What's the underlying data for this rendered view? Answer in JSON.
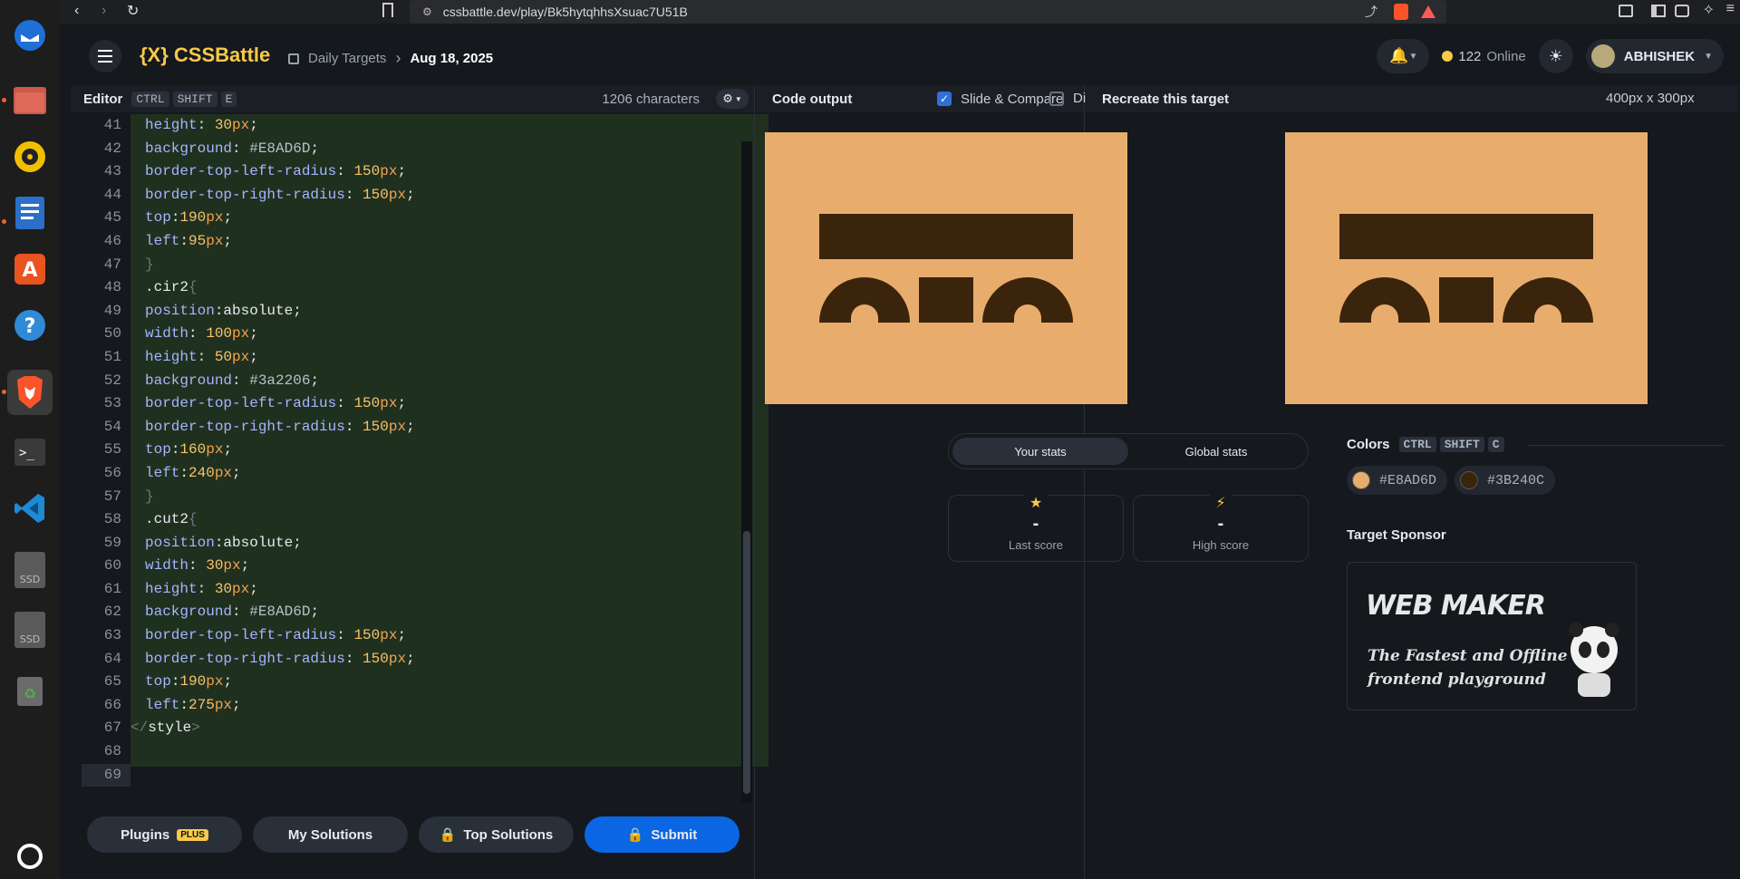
{
  "browser": {
    "url": "cssbattle.dev/play/Bk5hytqhhsXsuac7U51B"
  },
  "dock": {
    "items": [
      "thunderbird-icon",
      "files-icon",
      "rhythmbox-icon",
      "writer-icon",
      "app-center-icon",
      "help-icon",
      "brave-icon",
      "terminal-icon",
      "vscode-icon",
      "ssd-drive-icon",
      "ssd-drive-icon",
      "trash-icon"
    ],
    "ssd_label": "SSD"
  },
  "header": {
    "logo": "{X} CSSBattle",
    "breadcrumb_section": "Daily Targets",
    "breadcrumb_date": "Aug 18, 2025",
    "online_count": "122",
    "online_label": "Online",
    "user_name": "ABHISHEK"
  },
  "editor": {
    "title": "Editor",
    "shortcut": [
      "CTRL",
      "SHIFT",
      "E"
    ],
    "char_count": "1206 characters",
    "lines": [
      {
        "n": "41",
        "indent": 1,
        "parts": [
          [
            "prop",
            "height"
          ],
          [
            "sel",
            ": "
          ],
          [
            "num",
            "30"
          ],
          [
            "unit",
            "px"
          ],
          [
            "sel",
            ";"
          ]
        ]
      },
      {
        "n": "42",
        "indent": 1,
        "parts": [
          [
            "prop",
            "background"
          ],
          [
            "sel",
            ": "
          ],
          [
            "hex",
            "#E8AD6D"
          ],
          [
            "sel",
            ";"
          ]
        ]
      },
      {
        "n": "43",
        "indent": 1,
        "parts": [
          [
            "prop",
            "border-top-left-radius"
          ],
          [
            "sel",
            ": "
          ],
          [
            "num",
            "150"
          ],
          [
            "unit",
            "px"
          ],
          [
            "sel",
            ";"
          ]
        ]
      },
      {
        "n": "44",
        "indent": 1,
        "parts": [
          [
            "prop",
            "border-top-right-radius"
          ],
          [
            "sel",
            ": "
          ],
          [
            "num",
            "150"
          ],
          [
            "unit",
            "px"
          ],
          [
            "sel",
            ";"
          ]
        ]
      },
      {
        "n": "45",
        "indent": 1,
        "parts": [
          [
            "prop",
            "top"
          ],
          [
            "sel",
            ":"
          ],
          [
            "num",
            "190"
          ],
          [
            "unit",
            "px"
          ],
          [
            "sel",
            ";"
          ]
        ]
      },
      {
        "n": "46",
        "indent": 1,
        "parts": [
          [
            "prop",
            "left"
          ],
          [
            "sel",
            ":"
          ],
          [
            "num",
            "95"
          ],
          [
            "unit",
            "px"
          ],
          [
            "sel",
            ";"
          ]
        ]
      },
      {
        "n": "47",
        "indent": 1,
        "parts": [
          [
            "br",
            "}"
          ]
        ]
      },
      {
        "n": "48",
        "indent": 1,
        "parts": [
          [
            "sel",
            ".cir2"
          ],
          [
            "br",
            "{"
          ]
        ]
      },
      {
        "n": "49",
        "indent": 1,
        "parts": [
          [
            "prop",
            "position"
          ],
          [
            "sel",
            ":absolute;"
          ]
        ]
      },
      {
        "n": "50",
        "indent": 1,
        "parts": [
          [
            "prop",
            "width"
          ],
          [
            "sel",
            ": "
          ],
          [
            "num",
            "100"
          ],
          [
            "unit",
            "px"
          ],
          [
            "sel",
            ";"
          ]
        ]
      },
      {
        "n": "51",
        "indent": 1,
        "parts": [
          [
            "prop",
            "height"
          ],
          [
            "sel",
            ": "
          ],
          [
            "num",
            "50"
          ],
          [
            "unit",
            "px"
          ],
          [
            "sel",
            ";"
          ]
        ]
      },
      {
        "n": "52",
        "indent": 1,
        "parts": [
          [
            "prop",
            "background"
          ],
          [
            "sel",
            ": "
          ],
          [
            "hex",
            "#3a2206"
          ],
          [
            "sel",
            ";"
          ]
        ]
      },
      {
        "n": "53",
        "indent": 1,
        "parts": [
          [
            "prop",
            "border-top-left-radius"
          ],
          [
            "sel",
            ": "
          ],
          [
            "num",
            "150"
          ],
          [
            "unit",
            "px"
          ],
          [
            "sel",
            ";"
          ]
        ]
      },
      {
        "n": "54",
        "indent": 1,
        "parts": [
          [
            "prop",
            "border-top-right-radius"
          ],
          [
            "sel",
            ": "
          ],
          [
            "num",
            "150"
          ],
          [
            "unit",
            "px"
          ],
          [
            "sel",
            ";"
          ]
        ]
      },
      {
        "n": "55",
        "indent": 1,
        "parts": [
          [
            "prop",
            "top"
          ],
          [
            "sel",
            ":"
          ],
          [
            "num",
            "160"
          ],
          [
            "unit",
            "px"
          ],
          [
            "sel",
            ";"
          ]
        ]
      },
      {
        "n": "56",
        "indent": 1,
        "parts": [
          [
            "prop",
            "left"
          ],
          [
            "sel",
            ":"
          ],
          [
            "num",
            "240"
          ],
          [
            "unit",
            "px"
          ],
          [
            "sel",
            ";"
          ]
        ]
      },
      {
        "n": "57",
        "indent": 1,
        "parts": [
          [
            "br",
            "}"
          ]
        ]
      },
      {
        "n": "58",
        "indent": 1,
        "parts": [
          [
            "sel",
            ".cut2"
          ],
          [
            "br",
            "{"
          ]
        ]
      },
      {
        "n": "59",
        "indent": 1,
        "parts": [
          [
            "prop",
            "position"
          ],
          [
            "sel",
            ":absolute;"
          ]
        ]
      },
      {
        "n": "60",
        "indent": 1,
        "parts": [
          [
            "prop",
            "width"
          ],
          [
            "sel",
            ": "
          ],
          [
            "num",
            "30"
          ],
          [
            "unit",
            "px"
          ],
          [
            "sel",
            ";"
          ]
        ]
      },
      {
        "n": "61",
        "indent": 1,
        "parts": [
          [
            "prop",
            "height"
          ],
          [
            "sel",
            ": "
          ],
          [
            "num",
            "30"
          ],
          [
            "unit",
            "px"
          ],
          [
            "sel",
            ";"
          ]
        ]
      },
      {
        "n": "62",
        "indent": 1,
        "parts": [
          [
            "prop",
            "background"
          ],
          [
            "sel",
            ": "
          ],
          [
            "hex",
            "#E8AD6D"
          ],
          [
            "sel",
            ";"
          ]
        ]
      },
      {
        "n": "63",
        "indent": 1,
        "parts": [
          [
            "prop",
            "border-top-left-radius"
          ],
          [
            "sel",
            ": "
          ],
          [
            "num",
            "150"
          ],
          [
            "unit",
            "px"
          ],
          [
            "sel",
            ";"
          ]
        ]
      },
      {
        "n": "64",
        "indent": 1,
        "parts": [
          [
            "prop",
            "border-top-right-radius"
          ],
          [
            "sel",
            ": "
          ],
          [
            "num",
            "150"
          ],
          [
            "unit",
            "px"
          ],
          [
            "sel",
            ";"
          ]
        ]
      },
      {
        "n": "65",
        "indent": 1,
        "parts": [
          [
            "prop",
            "top"
          ],
          [
            "sel",
            ":"
          ],
          [
            "num",
            "190"
          ],
          [
            "unit",
            "px"
          ],
          [
            "sel",
            ";"
          ]
        ]
      },
      {
        "n": "66",
        "indent": 1,
        "parts": [
          [
            "prop",
            "left"
          ],
          [
            "sel",
            ":"
          ],
          [
            "num",
            "275"
          ],
          [
            "unit",
            "px"
          ],
          [
            "sel",
            ";"
          ]
        ]
      },
      {
        "n": "67",
        "indent": 0,
        "parts": [
          [
            "br",
            "</"
          ],
          [
            "sel",
            "style"
          ],
          [
            "br",
            ">"
          ]
        ]
      },
      {
        "n": "68",
        "indent": 0,
        "parts": []
      },
      {
        "n": "69",
        "indent": 0,
        "parts": []
      }
    ]
  },
  "footer_buttons": {
    "plugins": "Plugins",
    "plus_badge": "PLUS",
    "my_solutions": "My Solutions",
    "top_solutions": "Top Solutions",
    "submit": "Submit"
  },
  "output": {
    "title": "Code output",
    "slide_compare": "Slide & Compare",
    "diff": "Diff",
    "slide_checked": true,
    "diff_checked": false
  },
  "stats": {
    "tab_yours": "Your stats",
    "tab_global": "Global stats",
    "last_score_value": "-",
    "last_score_label": "Last score",
    "high_score_value": "-",
    "high_score_label": "High score"
  },
  "target": {
    "title": "Recreate this target",
    "size": "400px x 300px",
    "colors_title": "Colors",
    "colors_shortcut": [
      "CTRL",
      "SHIFT",
      "C"
    ],
    "colors": [
      {
        "hex": "#E8AD6D",
        "label": "#E8AD6D"
      },
      {
        "hex": "#3B240C",
        "label": "#3B240C"
      }
    ],
    "sponsor_title": "Target Sponsor",
    "sponsor_brand": "WEB MAKER",
    "sponsor_tagline_1": "The Fastest and Offline",
    "sponsor_tagline_2": "frontend playground"
  },
  "colors": {
    "bg_main": "#15181d",
    "target_bg": "#E8AD6D",
    "target_fg": "#3B240C",
    "accent": "#0b66e4",
    "logo": "#f7c948"
  }
}
